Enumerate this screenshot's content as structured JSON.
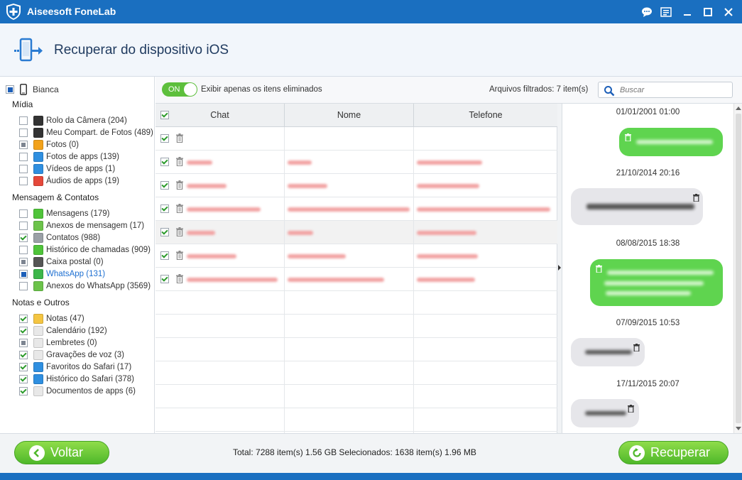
{
  "app": {
    "title": "Aiseesoft FoneLab"
  },
  "titlebar_buttons": [
    "chat-icon",
    "menu-icon",
    "minimize-icon",
    "maximize-icon",
    "close-icon"
  ],
  "header": {
    "title": "Recuperar do dispositivo iOS"
  },
  "sidebar": {
    "device": "Bianca",
    "sections": [
      {
        "title": "Mídia",
        "items": [
          {
            "label": "Rolo da Câmera (204)",
            "state": "unchecked",
            "icon": "camera-icon",
            "color": "#333333"
          },
          {
            "label": "Meu Compart. de Fotos (489)",
            "state": "unchecked",
            "icon": "photo-stream-icon",
            "color": "#333333"
          },
          {
            "label": "Fotos (0)",
            "state": "partial",
            "icon": "photos-icon",
            "color": "#f2a21b"
          },
          {
            "label": "Fotos de apps (139)",
            "state": "unchecked",
            "icon": "app-photos-icon",
            "color": "#2f8fe0"
          },
          {
            "label": "Vídeos de apps (1)",
            "state": "unchecked",
            "icon": "app-videos-icon",
            "color": "#2f8fe0"
          },
          {
            "label": "Áudios de apps (19)",
            "state": "unchecked",
            "icon": "app-audio-icon",
            "color": "#e5483a"
          }
        ]
      },
      {
        "title": "Mensagem & Contatos",
        "items": [
          {
            "label": "Mensagens (179)",
            "state": "unchecked",
            "icon": "messages-icon",
            "color": "#4fc43a"
          },
          {
            "label": "Anexos de mensagem (17)",
            "state": "unchecked",
            "icon": "attachment-icon",
            "color": "#6cc34a"
          },
          {
            "label": "Contatos (988)",
            "state": "checked",
            "icon": "contacts-icon",
            "color": "#9aa0a6"
          },
          {
            "label": "Histórico de chamadas (909)",
            "state": "unchecked",
            "icon": "phone-icon",
            "color": "#4fc43a"
          },
          {
            "label": "Caixa postal (0)",
            "state": "partial",
            "icon": "voicemail-icon",
            "color": "#555555"
          },
          {
            "label": "WhatsApp (131)",
            "state": "blue",
            "icon": "whatsapp-icon",
            "color": "#3cb64a",
            "active": true
          },
          {
            "label": "Anexos do WhatsApp (3569)",
            "state": "unchecked",
            "icon": "whatsapp-attachment-icon",
            "color": "#6cc34a"
          }
        ]
      },
      {
        "title": "Notas e Outros",
        "items": [
          {
            "label": "Notas (47)",
            "state": "checked",
            "icon": "notes-icon",
            "color": "#f4c542"
          },
          {
            "label": "Calendário (192)",
            "state": "checked",
            "icon": "calendar-icon",
            "color": "#e8e8e8"
          },
          {
            "label": "Lembretes (0)",
            "state": "partial",
            "icon": "reminders-icon",
            "color": "#e8e8e8"
          },
          {
            "label": "Gravações de voz (3)",
            "state": "checked",
            "icon": "voice-memo-icon",
            "color": "#e8e8e8"
          },
          {
            "label": "Favoritos do Safari (17)",
            "state": "checked",
            "icon": "bookmark-icon",
            "color": "#2f8fe0"
          },
          {
            "label": "Histórico do Safari (378)",
            "state": "checked",
            "icon": "safari-icon",
            "color": "#2f8fe0"
          },
          {
            "label": "Documentos de apps (6)",
            "state": "checked",
            "icon": "document-icon",
            "color": "#e8e8e8"
          }
        ]
      }
    ]
  },
  "toolbar": {
    "toggle_label": "ON",
    "filter_label": "Exibir apenas os itens eliminados",
    "filtered_count": "Arquivos filtrados: 7 item(s)",
    "search_placeholder": "Buscar"
  },
  "table": {
    "columns": [
      "Chat",
      "Nome",
      "Telefone"
    ],
    "rows": [
      {
        "checked": true,
        "selected": false,
        "chat": 0,
        "name": 0,
        "phone": 0
      },
      {
        "checked": true,
        "selected": false,
        "chat": 36,
        "name": 34,
        "phone": 92
      },
      {
        "checked": true,
        "selected": false,
        "chat": 56,
        "name": 56,
        "phone": 88
      },
      {
        "checked": true,
        "selected": false,
        "chat": 104,
        "name": 172,
        "phone": 188
      },
      {
        "checked": true,
        "selected": true,
        "chat": 40,
        "name": 36,
        "phone": 84
      },
      {
        "checked": true,
        "selected": false,
        "chat": 70,
        "name": 82,
        "phone": 86
      },
      {
        "checked": true,
        "selected": false,
        "chat": 128,
        "name": 136,
        "phone": 82
      }
    ]
  },
  "chat": {
    "messages": [
      {
        "date": "01/01/2001 01:00",
        "dir": "out"
      },
      {
        "date": "21/10/2014 20:16",
        "dir": "in"
      },
      {
        "date": "08/08/2015 18:38",
        "dir": "out"
      },
      {
        "date": "07/09/2015 10:53",
        "dir": "in"
      },
      {
        "date": "17/11/2015 20:07",
        "dir": "in"
      }
    ]
  },
  "footer": {
    "back_label": "Voltar",
    "total": "Total: 7288 item(s) 1.56 GB Selecionados: 1638 item(s) 1.96 MB",
    "recover_label": "Recuperar"
  }
}
